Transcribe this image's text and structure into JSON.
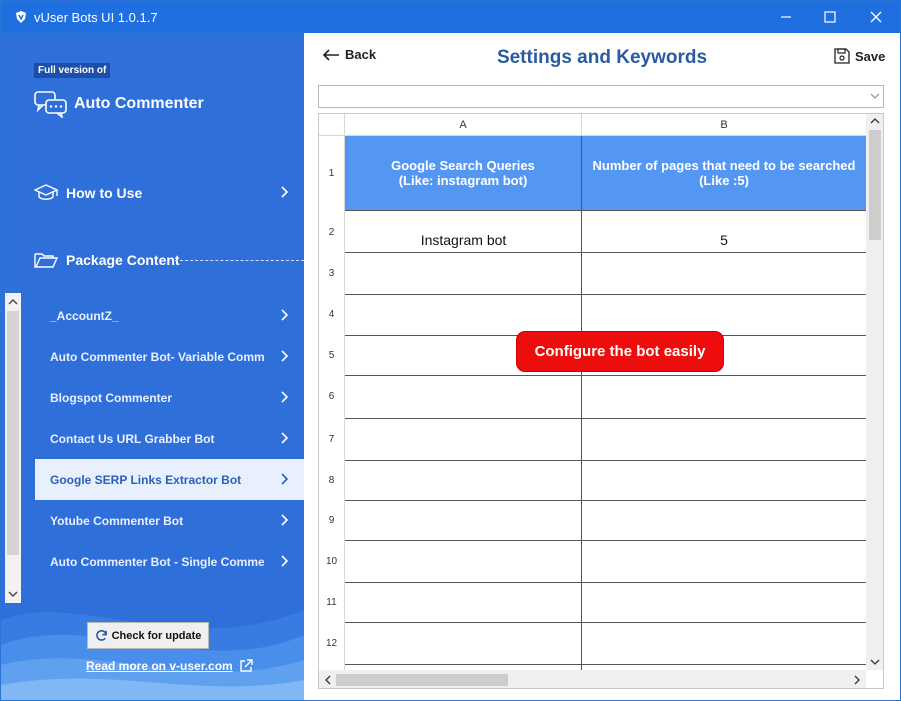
{
  "window": {
    "title": "vUser Bots UI 1.0.1.7",
    "controls": {
      "minimize": "minimize-icon",
      "maximize": "maximize-icon",
      "close": "close-icon"
    }
  },
  "sidebar": {
    "badge": "Full version of",
    "product_name": "Auto Commenter",
    "how_to_use": "How to Use",
    "package_content": "Package Content",
    "packages": [
      {
        "label": "_AccountZ_",
        "selected": false
      },
      {
        "label": "Auto Commenter Bot- Variable Comment Version",
        "selected": false
      },
      {
        "label": "Blogspot Commenter",
        "selected": false
      },
      {
        "label": "Contact Us URL Grabber Bot",
        "selected": false
      },
      {
        "label": "Google SERP Links Extractor Bot",
        "selected": true
      },
      {
        "label": "Yotube Commenter Bot",
        "selected": false
      },
      {
        "label": "Auto Commenter Bot - Single Comment",
        "selected": false
      }
    ],
    "check_update": "Check for update",
    "read_more": "Read more on v-user.com"
  },
  "main": {
    "back": "Back",
    "title": "Settings and Keywords",
    "save": "Save",
    "combo_value": ""
  },
  "grid": {
    "columns": [
      "A",
      "B"
    ],
    "header_a_line1": "Google Search Queries",
    "header_a_line2": "(Like: instagram bot)",
    "header_b_line1": "Number of pages that need to be searched",
    "header_b_line2": "(Like :5)",
    "row_numbers": [
      "1",
      "2",
      "3",
      "4",
      "5",
      "6",
      "7",
      "8",
      "9",
      "10",
      "11",
      "12"
    ],
    "rows": [
      {
        "a": "Instagram bot",
        "b": "5"
      }
    ]
  },
  "tooltip": "Configure the bot easily",
  "colors": {
    "titlebar": "#1f6fe0",
    "sidebar": "#2f6fd9",
    "header_cell": "#5497f2",
    "title_text": "#2a5b9f",
    "tooltip": "#ee0d0d"
  }
}
